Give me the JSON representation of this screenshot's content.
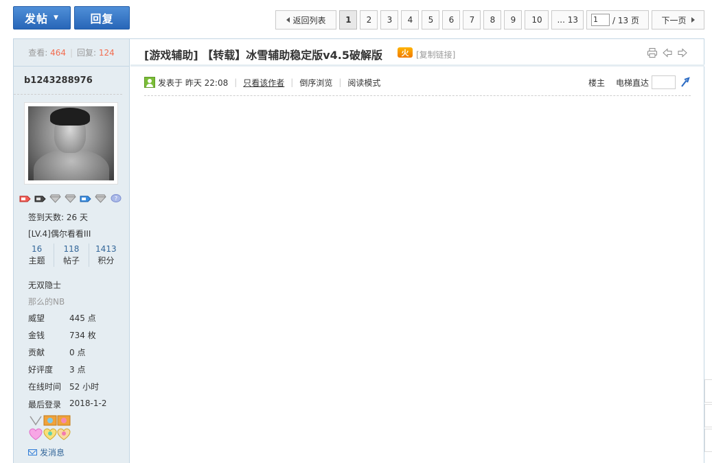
{
  "toolbar": {
    "post_label": "发帖",
    "reply_label": "回复"
  },
  "pager": {
    "back_label": "返回列表",
    "pages": [
      "1",
      "2",
      "3",
      "4",
      "5",
      "6",
      "7",
      "8",
      "9",
      "10"
    ],
    "current_page": "1",
    "last_label": "... 13",
    "page_input_value": "1",
    "total_label": "/ 13 页",
    "next_label": "下一页"
  },
  "thread": {
    "views_label": "查看:",
    "views": "464",
    "replies_label": "回复:",
    "replies": "124",
    "title": "[游戏辅助] 【转载】冰雪辅助稳定版v4.5破解版",
    "hot_badge": "火",
    "copy_link": "[复制链接]"
  },
  "author": {
    "username": "b1243288976",
    "checkin": "签到天数: 26 天",
    "level": "[LV.4]偶尔看看III",
    "counts": [
      {
        "value": "16",
        "label": "主题"
      },
      {
        "value": "118",
        "label": "帖子"
      },
      {
        "value": "1413",
        "label": "积分"
      }
    ],
    "title": "无双隐士",
    "subtitle": "那么的NB",
    "fields": [
      {
        "key": "威望",
        "value": "445 点"
      },
      {
        "key": "金钱",
        "value": "734 枚"
      },
      {
        "key": "贡献",
        "value": "0 点"
      },
      {
        "key": "好评度",
        "value": "3 点"
      },
      {
        "key": "在线时间",
        "value": "52 小时"
      },
      {
        "key": "最后登录",
        "value": "2018-1-2"
      }
    ],
    "send_message": "发消息"
  },
  "post_meta": {
    "posted_at": "发表于 昨天 22:08",
    "only_author": "只看该作者",
    "reverse": "倒序浏览",
    "read_mode": "阅读模式",
    "floor": "楼主",
    "elevator": "电梯直达"
  },
  "colors": {
    "accent_blue": "#2866b8",
    "sidebar_bg": "#e5edf2",
    "count_red": "#f26c4f"
  }
}
